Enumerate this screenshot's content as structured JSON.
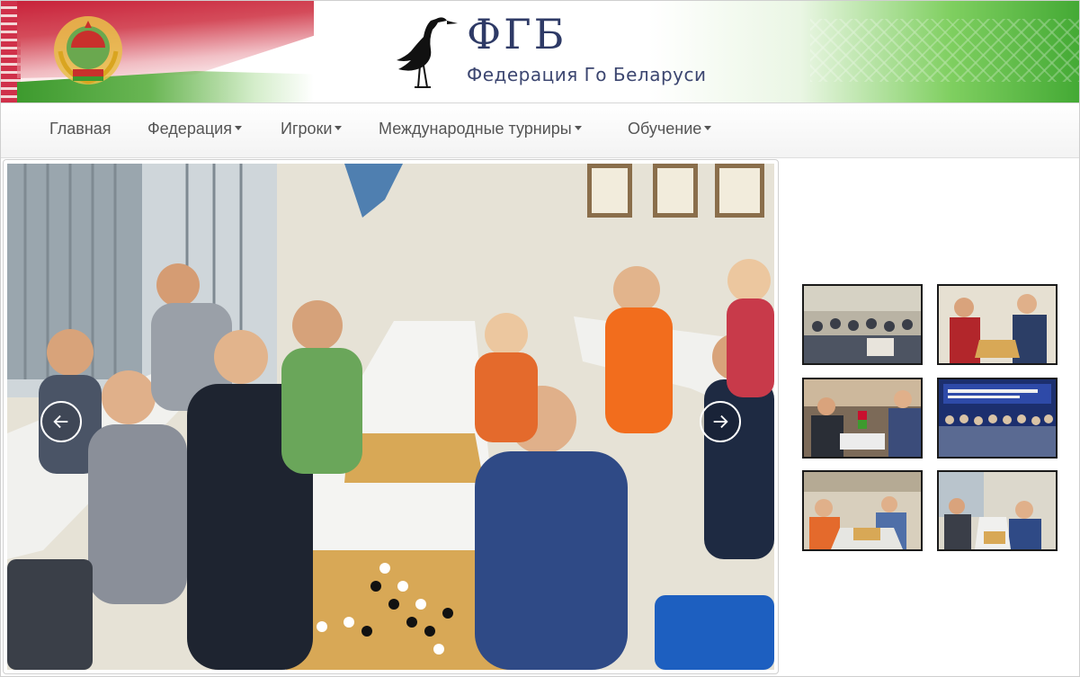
{
  "header": {
    "logo_title": "ФГБ",
    "logo_subtitle": "Федерация Го Беларуси",
    "emblem_icon": "belarus-coat-of-arms",
    "stork_icon": "stork-logo",
    "colors": {
      "flag_red": "#c8102e",
      "flag_green": "#43a934",
      "logo_text": "#2e3a66"
    }
  },
  "nav": {
    "items": [
      {
        "label": "Главная",
        "dropdown": false
      },
      {
        "label": "Федерация",
        "dropdown": true
      },
      {
        "label": "Игроки",
        "dropdown": true
      },
      {
        "label": "Международные турниры",
        "dropdown": true
      },
      {
        "label": "Обучение",
        "dropdown": true
      }
    ],
    "text_color": "#555555"
  },
  "carousel": {
    "slide_icon": "photo-children-playing-go",
    "prev_icon": "arrow-left-icon",
    "next_icon": "arrow-right-icon"
  },
  "thumbnails": [
    {
      "icon": "photo-tournament-hall"
    },
    {
      "icon": "photo-two-players"
    },
    {
      "icon": "photo-players-at-table"
    },
    {
      "icon": "photo-group-banner"
    },
    {
      "icon": "photo-children-class"
    },
    {
      "icon": "photo-children-tournament"
    }
  ]
}
